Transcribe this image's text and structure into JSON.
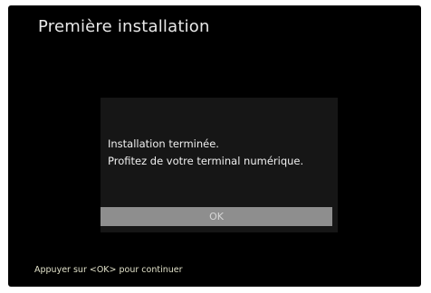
{
  "screen": {
    "title": "Première installation"
  },
  "dialog": {
    "message_lines": [
      "Installation terminée.",
      "Profitez de votre terminal numérique."
    ],
    "ok_label": "OK"
  },
  "footer": {
    "hint": "Appuyer sur <OK> pour continuer"
  },
  "colors": {
    "background": "#000000",
    "dialog_background": "#161616",
    "button_selected": "#8e8e8e",
    "text": "#f0f0f0"
  }
}
